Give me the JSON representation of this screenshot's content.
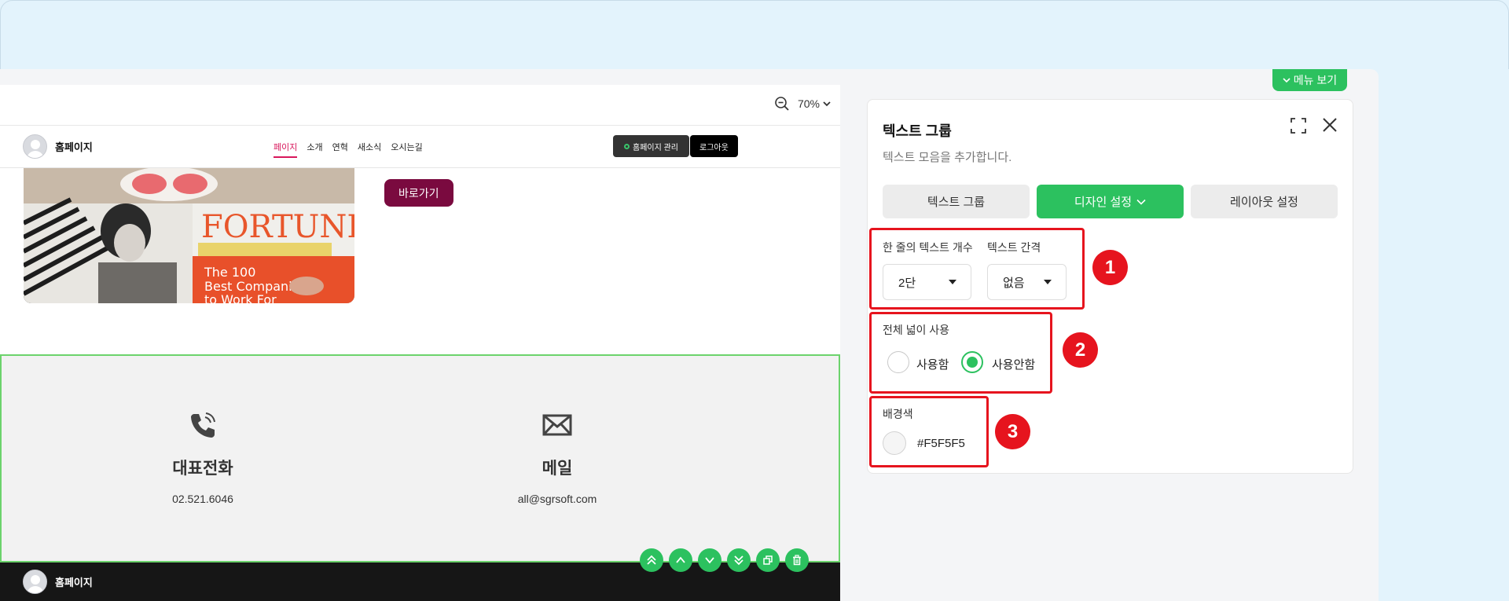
{
  "preview": {
    "zoom": "70%",
    "site": {
      "logo_text": "홈페이지",
      "nav": [
        "페이지",
        "소개",
        "연혁",
        "새소식",
        "오시는길"
      ],
      "active_nav": "페이지",
      "manage_button": "홈페이지 관리",
      "logout_button": "로그아웃"
    },
    "hero": {
      "button": "바로가기",
      "photo_text": [
        "FORTUNE",
        "The 100",
        "Best Compani",
        "to Work For"
      ]
    },
    "contact": {
      "phone": {
        "title": "대표전화",
        "value": "02.521.6046",
        "icon": "phone-icon"
      },
      "mail": {
        "title": "메일",
        "value": "all@sgrsoft.com",
        "icon": "mail-icon"
      }
    },
    "row_tools": [
      "move-top-icon",
      "move-up-icon",
      "move-down-icon",
      "move-bottom-icon",
      "copy-icon",
      "delete-icon"
    ],
    "footer": {
      "logo_text": "홈페이지"
    }
  },
  "menu_toggle": {
    "label": "메뉴 보기"
  },
  "panel": {
    "title": "텍스트 그룹",
    "description": "텍스트 모음을 추가합니다.",
    "tabs": [
      {
        "label": "텍스트 그룹",
        "active": false
      },
      {
        "label": "디자인 설정",
        "active": true
      },
      {
        "label": "레이아웃 설정",
        "active": false
      }
    ],
    "per_line": {
      "label": "한 줄의 텍스트 개수",
      "value": "2단"
    },
    "spacing": {
      "label": "텍스트 간격",
      "value": "없음"
    },
    "full_width": {
      "label": "전체 넓이 사용",
      "options": [
        {
          "label": "사용함",
          "checked": false
        },
        {
          "label": "사용안함",
          "checked": true
        }
      ]
    },
    "background": {
      "label": "배경색",
      "value": "#F5F5F5"
    },
    "badges": [
      "1",
      "2",
      "3"
    ]
  },
  "colors": {
    "accent_green": "#2CC15F",
    "highlight_red": "#E6141E",
    "brand_wine": "#7A0A3F",
    "nav_active": "#D8175B"
  }
}
